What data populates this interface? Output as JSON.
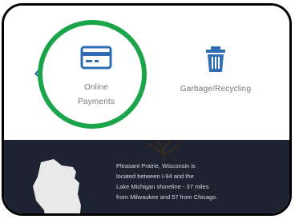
{
  "nav": {
    "back_icon": "chevron-left-icon"
  },
  "tiles": [
    {
      "label_line1": "Online",
      "label_line2": "Payments",
      "icon": "credit-card-icon",
      "highlighted": true
    },
    {
      "label": "Garbage/Recycling",
      "icon": "trash-can-icon"
    }
  ],
  "info": {
    "line1": "Pleasant Prairie, Wisconsin is",
    "line2": "located between I-94 and the",
    "line3": "Lake Michigan shoreline - 37 miles",
    "line4": "from Milwaukee and 57 from Chicago."
  },
  "colors": {
    "accent_blue": "#2e6db5",
    "highlight_green": "#1aa54a",
    "panel_dark": "#1e2331",
    "map_marker": "#e8a23a"
  }
}
